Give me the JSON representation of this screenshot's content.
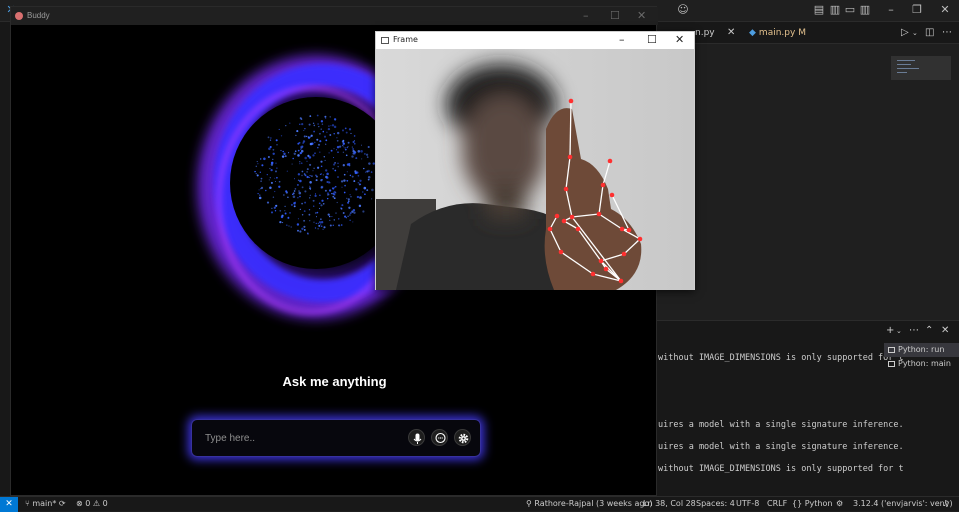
{
  "vscode": {
    "titlebar_icons": [
      "account-icon",
      "layout-icon"
    ],
    "tabs": [
      {
        "label": "n.py",
        "modified": false
      },
      {
        "label": "main.py",
        "modified": true,
        "modified_marker": "M"
      }
    ],
    "terminal_lines": [
      "without IMAGE_DIMENSIONS is only supported for t",
      "uires a model with a single signature inference.",
      "uires a model with a single signature inference.",
      "without IMAGE_DIMENSIONS is only supported for t"
    ],
    "terminals": [
      "Python: run",
      "Python: main"
    ],
    "statusbar": {
      "branch": "main*",
      "errors": "0",
      "warnings": "0",
      "blame": "Rathore-Rajpal (3 weeks ago)",
      "position": "Ln 38, Col 28",
      "spaces": "Spaces: 4",
      "encoding": "UTF-8",
      "eol": "CRLF",
      "language": "{} Python",
      "interpreter": "3.12.4 ('envjarvis': venv)"
    }
  },
  "buddy": {
    "title": "Buddy",
    "prompt": "Ask me anything",
    "input_placeholder": "Type here..",
    "buttons": [
      "microphone-icon",
      "chat-icon",
      "settings-icon"
    ],
    "colors": {
      "ring": "#3a2dff",
      "glow": "#7a2cff",
      "sphere_dots": "#2f5bff"
    }
  },
  "frame": {
    "title": "Frame"
  }
}
